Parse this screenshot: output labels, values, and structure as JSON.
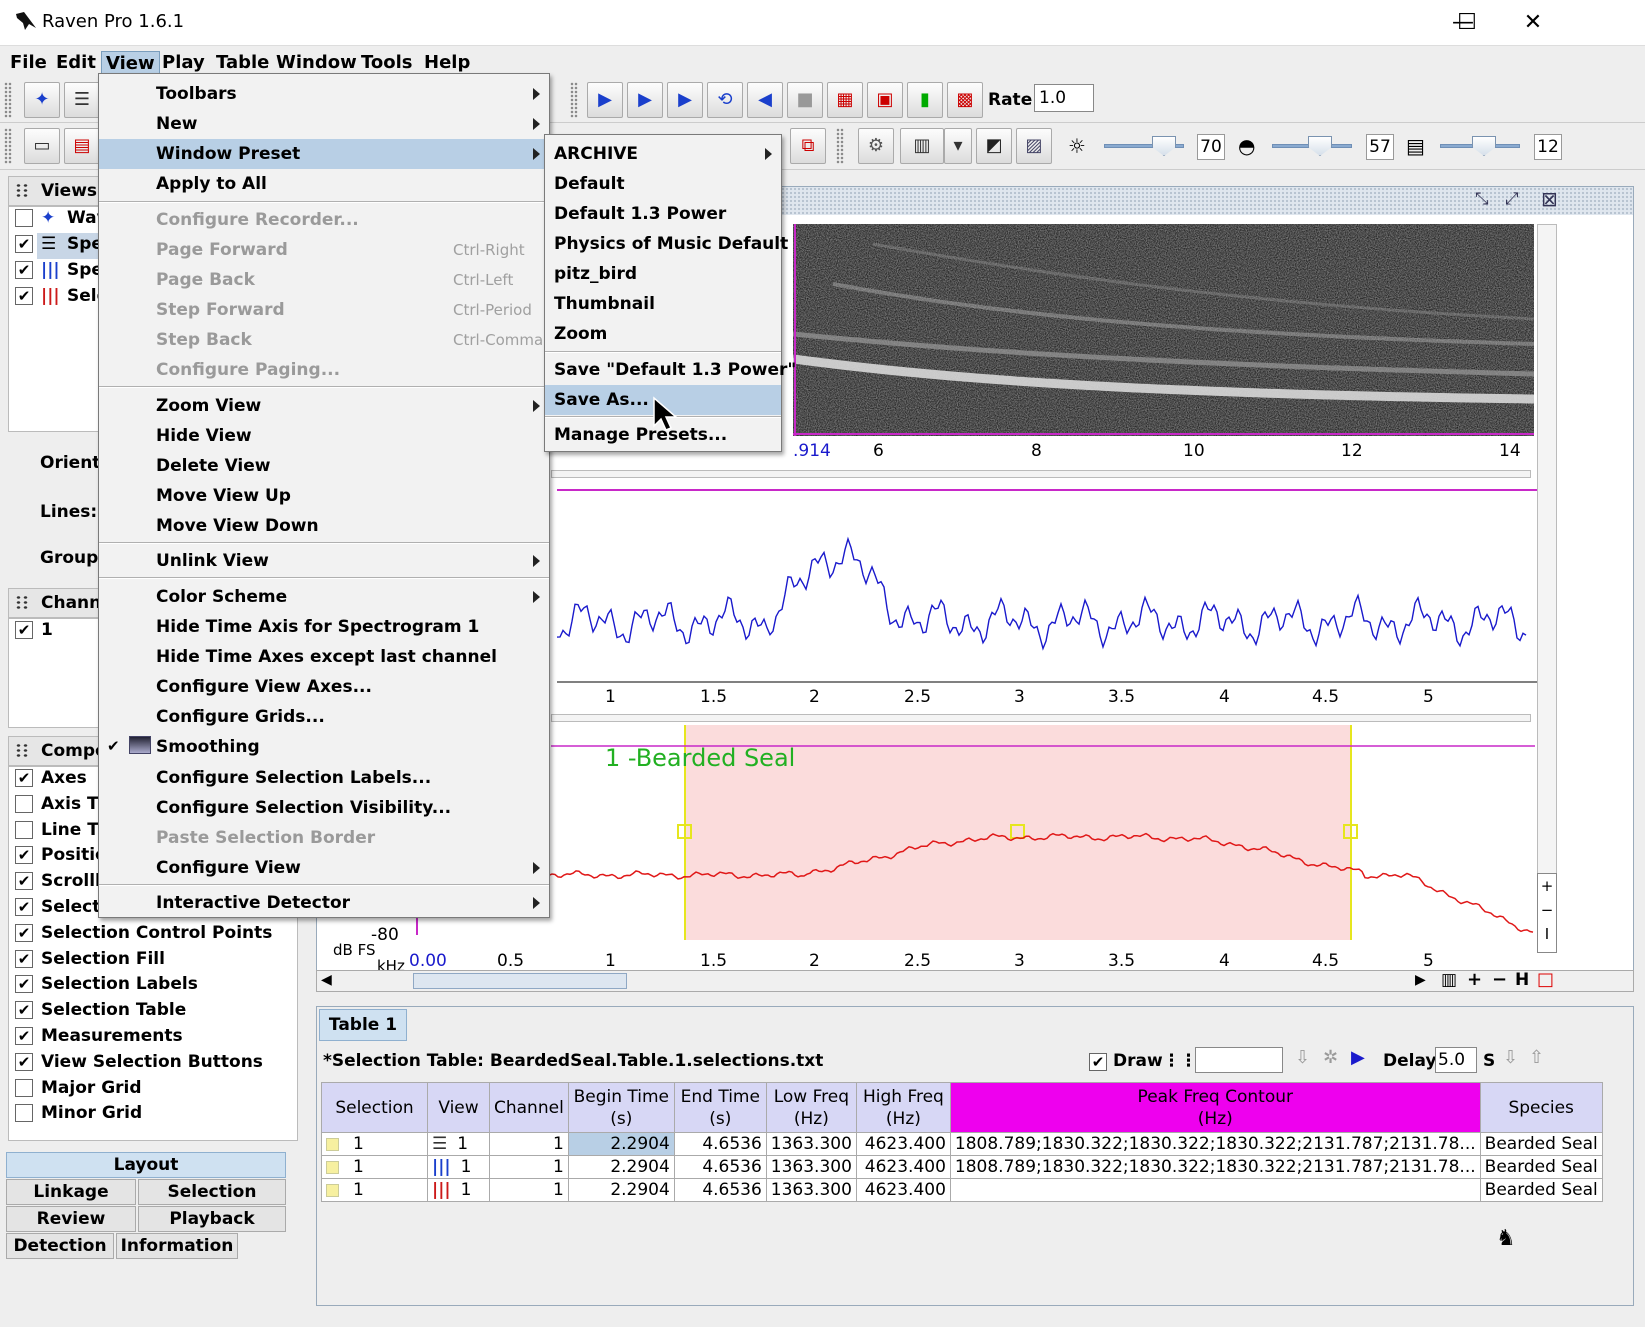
{
  "app": {
    "title": "Raven Pro 1.6.1",
    "minimize": "—",
    "maximize": "☐",
    "close": "✕"
  },
  "menubar": [
    "File",
    "Edit",
    "View",
    "Play",
    "Table",
    "Window",
    "Tools",
    "Help"
  ],
  "toolbar": {
    "rate_label": "Rate:",
    "rate_value": "1.0",
    "brightness": "70",
    "contrast": "57",
    "resolution": "12"
  },
  "left": {
    "views_header": "Views:",
    "views": [
      {
        "label": "Wav",
        "checked": false
      },
      {
        "label": "Spe",
        "checked": true
      },
      {
        "label": "Spe",
        "checked": true
      },
      {
        "label": "Sele",
        "checked": true
      }
    ],
    "orientation_label": "Orienta",
    "lines_label": "Lines:",
    "group_label": "Group",
    "channels_header": "Chann",
    "channel_1": "1",
    "components_header": "Compo",
    "components": [
      {
        "label": "Axes",
        "checked": true
      },
      {
        "label": "Axis Tit",
        "checked": false
      },
      {
        "label": "Line Tit",
        "checked": false
      },
      {
        "label": "Positio",
        "checked": true
      },
      {
        "label": "Scrollb",
        "checked": true
      },
      {
        "label": "Selectio",
        "checked": true
      },
      {
        "label": "Selection Control Points",
        "checked": true
      },
      {
        "label": "Selection Fill",
        "checked": true
      },
      {
        "label": "Selection Labels",
        "checked": true
      },
      {
        "label": "Selection Table",
        "checked": true
      },
      {
        "label": "Measurements",
        "checked": true
      },
      {
        "label": "View Selection Buttons",
        "checked": true
      },
      {
        "label": "Major Grid",
        "checked": false
      },
      {
        "label": "Minor Grid",
        "checked": false
      }
    ],
    "tabs": {
      "layout": "Layout",
      "linkage": "Linkage",
      "selection": "Selection",
      "review": "Review",
      "playback": "Playback",
      "detection": "Detection",
      "information": "Information"
    }
  },
  "view_menu": {
    "items": [
      {
        "label": "Toolbars",
        "u": "",
        "sub": true
      },
      {
        "label": "New",
        "sub": true
      },
      {
        "label": "Window Preset",
        "sub": true
      },
      {
        "label": "Apply to All"
      },
      {
        "label": "Configure Recorder...",
        "disabled": true
      },
      {
        "label": "Page Forward",
        "shortcut": "Ctrl-Right",
        "disabled": true
      },
      {
        "label": "Page Back",
        "shortcut": "Ctrl-Left",
        "disabled": true
      },
      {
        "label": "Step Forward",
        "shortcut": "Ctrl-Period",
        "disabled": true
      },
      {
        "label": "Step Back",
        "shortcut": "Ctrl-Comma",
        "disabled": true
      },
      {
        "label": "Configure Paging...",
        "disabled": true
      },
      {
        "label": "Zoom View",
        "sub": true
      },
      {
        "label": "Hide View"
      },
      {
        "label": "Delete View"
      },
      {
        "label": "Move View Up"
      },
      {
        "label": "Move View Down"
      },
      {
        "label": "Unlink View",
        "sub": true
      },
      {
        "label": "Color Scheme",
        "sub": true
      },
      {
        "label": "Hide Time Axis for Spectrogram 1"
      },
      {
        "label": "Hide Time Axes except last channel"
      },
      {
        "label": "Configure View Axes..."
      },
      {
        "label": "Configure Grids..."
      },
      {
        "label": "Smoothing",
        "checked": true
      },
      {
        "label": "Configure Selection Labels..."
      },
      {
        "label": "Configure Selection Visibility..."
      },
      {
        "label": "Paste Selection Border",
        "disabled": true
      },
      {
        "label": "Configure View",
        "sub": true
      },
      {
        "label": "Interactive Detector",
        "sub": true
      }
    ]
  },
  "preset_menu": {
    "items": [
      "ARCHIVE",
      "Default",
      "Default 1.3 Power",
      "Physics of Music Default",
      "pitz_bird",
      "Thumbnail",
      "Zoom",
      "Save \"Default 1.3 Power\"",
      "Save As...",
      "Manage Presets..."
    ]
  },
  "spectrogram": {
    "axis_start": ".914",
    "ticks": [
      "6",
      "8",
      "10",
      "12",
      "14"
    ]
  },
  "waveform": {
    "ticks": [
      "1",
      "1.5",
      "2",
      "2.5",
      "3",
      "3.5",
      "4",
      "4.5",
      "5"
    ]
  },
  "spectrum": {
    "ticks": [
      "0.00",
      "0.5",
      "1",
      "1.5",
      "2",
      "2.5",
      "3",
      "3.5",
      "4",
      "4.5",
      "5"
    ],
    "y_label_db": "-80",
    "db_unit": "dB FS",
    "khz_unit": "kHz",
    "selection_label": "1 -Bearded Seal"
  },
  "table": {
    "tab": "Table 1",
    "title": "*Selection Table: BeardedSeal.Table.1.selections.txt",
    "draw_label": "Draw",
    "delay_label": "Delay:",
    "delay_value": "5.0",
    "delay_unit": "S",
    "headers": [
      [
        "Selection",
        ""
      ],
      [
        "View",
        ""
      ],
      [
        "Channel",
        ""
      ],
      [
        "Begin Time",
        "(s)"
      ],
      [
        "End Time",
        "(s)"
      ],
      [
        "Low Freq",
        "(Hz)"
      ],
      [
        "High Freq",
        "(Hz)"
      ],
      [
        "Peak Freq Contour",
        "(Hz)"
      ],
      [
        "Species",
        ""
      ]
    ],
    "rows": [
      [
        "1",
        "1",
        "1",
        "2.2904",
        "4.6536",
        "1363.300",
        "4623.400",
        "1808.789;1830.322;1830.322;1830.322;2131.787;2131.78...",
        "Bearded Seal"
      ],
      [
        "1",
        "1",
        "1",
        "2.2904",
        "4.6536",
        "1363.300",
        "4623.400",
        "1808.789;1830.322;1830.322;1830.322;2131.787;2131.78...",
        "Bearded Seal"
      ],
      [
        "1",
        "1",
        "1",
        "2.2904",
        "4.6536",
        "1363.300",
        "4623.400",
        "",
        "Bearded Seal"
      ]
    ]
  }
}
